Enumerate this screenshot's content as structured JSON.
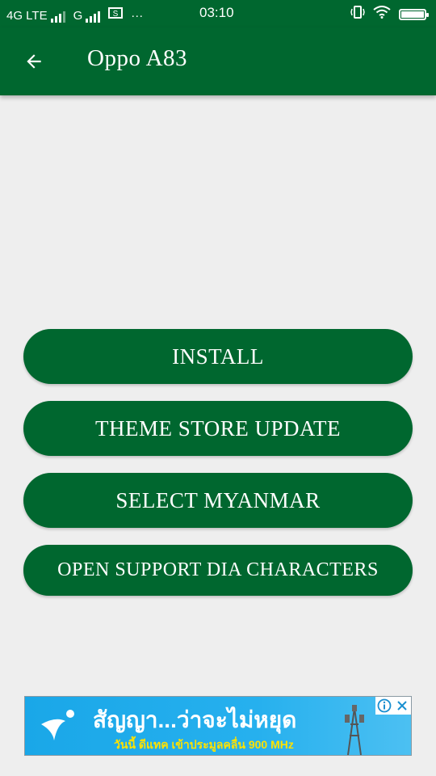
{
  "status_bar": {
    "network_1": "4G LTE",
    "network_2": "G",
    "more": "···",
    "time": "03:10",
    "battery_level": 1.0
  },
  "app_bar": {
    "title": "Oppo A83",
    "back_icon": "arrow-left-icon"
  },
  "buttons": {
    "install": "INSTALL",
    "theme_store_update": "THEME STORE UPDATE",
    "select_myanmar": "SELECT MYANMAR",
    "open_support": "OPEN SUPPORT DIA CHARACTERS"
  },
  "ad": {
    "headline": "สัญญา...ว่าจะไม่หยุด",
    "subline": "วันนี้ ดีแทค เข้าประมูลคลื่น 900 MHz",
    "info_icon": "info-icon",
    "close_icon": "close-icon"
  },
  "colors": {
    "primary": "#00672f",
    "background": "#eeeeee",
    "ad_blue": "#1aa7e8",
    "ad_yellow": "#ffe200"
  }
}
